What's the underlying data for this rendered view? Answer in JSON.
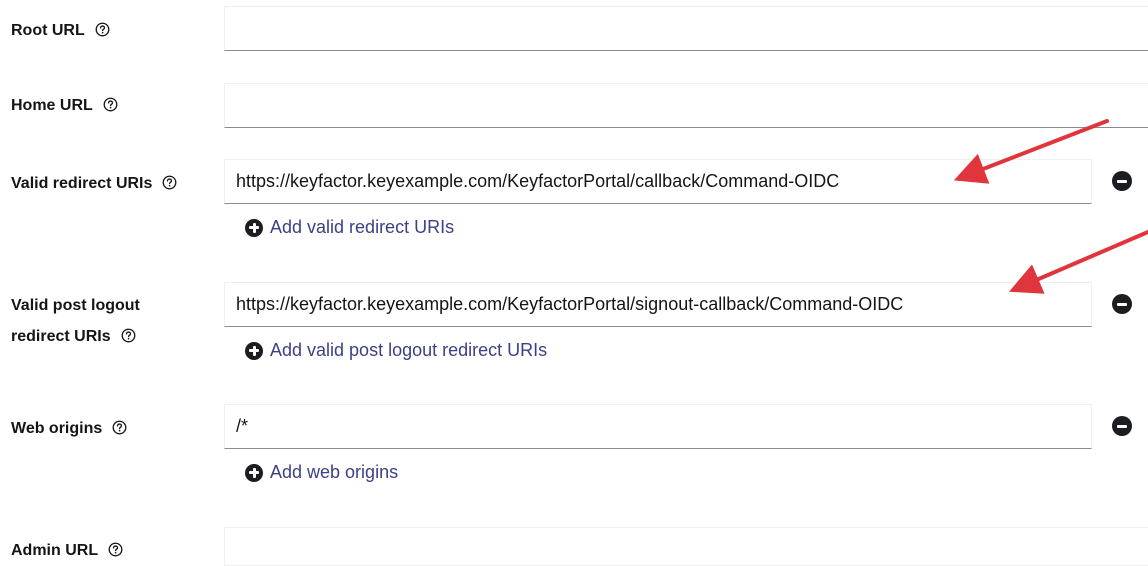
{
  "fields": {
    "root_url": {
      "label": "Root URL",
      "value": ""
    },
    "home_url": {
      "label": "Home URL",
      "value": ""
    },
    "valid_redirect": {
      "label": "Valid redirect URIs",
      "value": "https://keyfactor.keyexample.com/KeyfactorPortal/callback/Command-OIDC",
      "add_label": "Add valid redirect URIs"
    },
    "valid_post_logout": {
      "label_line1": "Valid post logout",
      "label_line2": "redirect URIs",
      "value": "https://keyfactor.keyexample.com/KeyfactorPortal/signout-callback/Command-OIDC",
      "add_label": "Add valid post logout redirect URIs"
    },
    "web_origins": {
      "label": "Web origins",
      "value": "/*",
      "add_label": "Add web origins"
    },
    "admin_url": {
      "label": "Admin URL",
      "value": ""
    }
  },
  "icons": {
    "help": "help-circle-icon",
    "remove": "minus-circle-icon",
    "add": "plus-circle-icon"
  },
  "colors": {
    "link": "#3c3f86",
    "annotation_arrow": "#e0353c",
    "field_underline": "#8a8d90"
  }
}
